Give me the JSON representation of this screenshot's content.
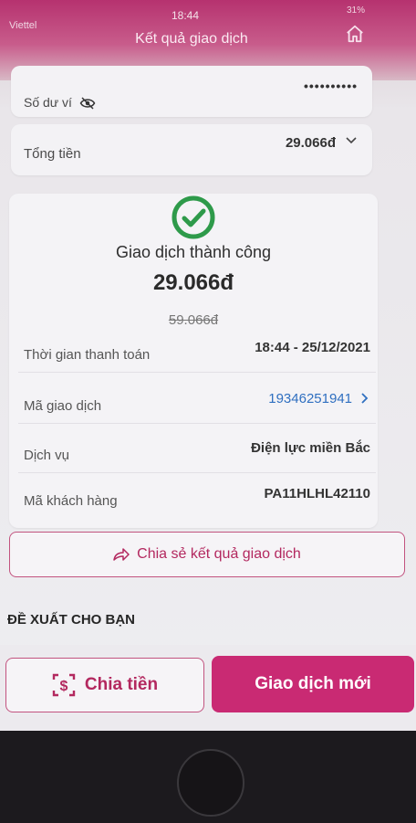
{
  "status_bar": {
    "carrier": "Viettel",
    "time": "18:44",
    "battery": "31%"
  },
  "header": {
    "title": "Kết quả giao dịch"
  },
  "balance": {
    "label": "Số dư ví",
    "masked_value": "••••••••••"
  },
  "total": {
    "label": "Tổng tiền",
    "value": "29.066đ"
  },
  "result": {
    "status": "Giao dịch thành công",
    "amount": "29.066đ",
    "original_amount": "59.066đ"
  },
  "details": [
    {
      "key": "Thời gian thanh toán",
      "value": "18:44 - 25/12/2021"
    },
    {
      "key": "Mã giao dịch",
      "value": "19346251941"
    },
    {
      "key": "Dịch vụ",
      "value": "Điện lực miền Bắc"
    },
    {
      "key": "Mã khách hàng",
      "value": "PA11HLHL42110"
    }
  ],
  "share": {
    "label": "Chia sẻ kết quả giao dịch"
  },
  "suggest": {
    "title": "ĐỀ XUẤT CHO BẠN"
  },
  "actions": {
    "split_label": "Chia tiền",
    "new_label": "Giao dịch mới"
  },
  "colors": {
    "brand": "#c92a73",
    "success": "#2e9a4a",
    "link": "#2f6fc0"
  }
}
